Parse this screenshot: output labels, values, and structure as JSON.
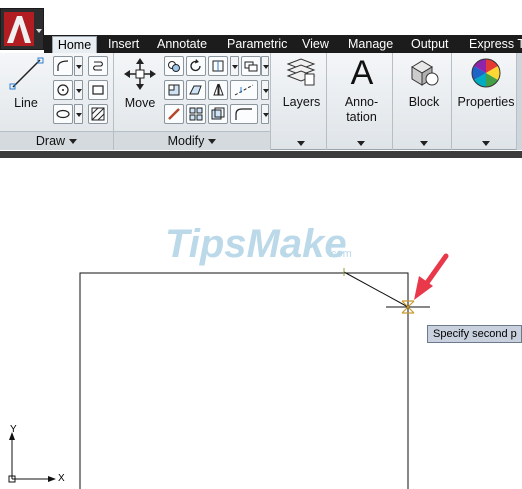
{
  "ribbon_tabs": [
    "Home",
    "Insert",
    "Annotate",
    "Parametric",
    "View",
    "Manage",
    "Output",
    "Express To"
  ],
  "panels": {
    "draw": {
      "title": "Draw",
      "line_label": "Line"
    },
    "modify": {
      "title": "Modify",
      "move_label": "Move"
    },
    "layers": {
      "label": "Layers"
    },
    "annotation": {
      "label_line1": "Anno-",
      "label_line2": "tation",
      "icon_letter": "A"
    },
    "block": {
      "label": "Block"
    },
    "properties": {
      "label": "Properties"
    }
  },
  "watermark": {
    "text": "TipsMake",
    "suffix": ".com"
  },
  "tooltip": {
    "text": "Specify second p"
  },
  "ucs": {
    "x": "X",
    "y": "Y"
  },
  "colors": {
    "tab_bar": "#1c1c1c",
    "ribbon": "#e4e8eb",
    "app_button_red": "#d2232a",
    "arrow_red": "#e8384a",
    "watermark": "#bcd9ea"
  }
}
